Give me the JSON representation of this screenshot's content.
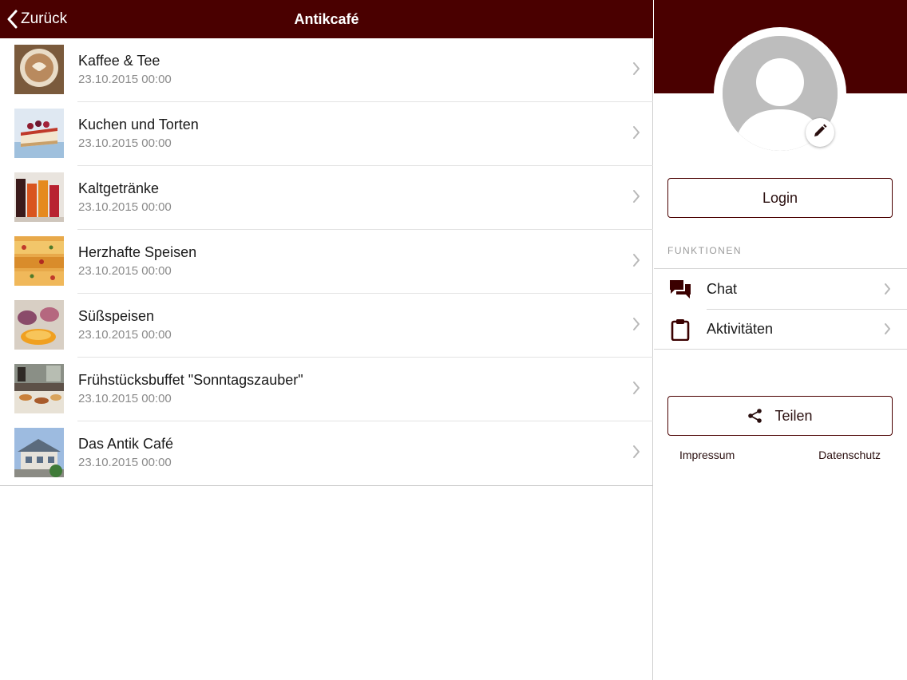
{
  "colors": {
    "brand": "#4a0000",
    "text": "#1a1a1a",
    "muted": "#8a8a8a",
    "divider": "#e3e3e3"
  },
  "navbar": {
    "back_label": "Zurück",
    "back_icon": "chevron-left-icon",
    "title": "Antikcafé"
  },
  "list": {
    "items": [
      {
        "title": "Kaffee & Tee",
        "date": "23.10.2015 00:00",
        "thumb": "coffee-image"
      },
      {
        "title": "Kuchen und Torten",
        "date": "23.10.2015 00:00",
        "thumb": "cake-image"
      },
      {
        "title": "Kaltgetränke",
        "date": "23.10.2015 00:00",
        "thumb": "cold-drinks-image"
      },
      {
        "title": "Herzhafte Speisen",
        "date": "23.10.2015 00:00",
        "thumb": "savory-food-image"
      },
      {
        "title": "Süßspeisen",
        "date": "23.10.2015 00:00",
        "thumb": "desserts-image"
      },
      {
        "title": "Frühstücksbuffet \"Sonntagszauber\"",
        "date": "23.10.2015 00:00",
        "thumb": "breakfast-buffet-image"
      },
      {
        "title": "Das Antik Café",
        "date": "23.10.2015 00:00",
        "thumb": "cafe-building-image"
      }
    ]
  },
  "profile": {
    "avatar_icon": "user-placeholder-icon",
    "edit_icon": "pencil-icon",
    "login_label": "Login"
  },
  "functions": {
    "header": "FUNKTIONEN",
    "items": [
      {
        "label": "Chat",
        "icon": "chat-bubbles-icon"
      },
      {
        "label": "Aktivitäten",
        "icon": "clipboard-icon"
      }
    ]
  },
  "share": {
    "label": "Teilen",
    "icon": "share-icon"
  },
  "footer": {
    "impressum": "Impressum",
    "datenschutz": "Datenschutz"
  }
}
